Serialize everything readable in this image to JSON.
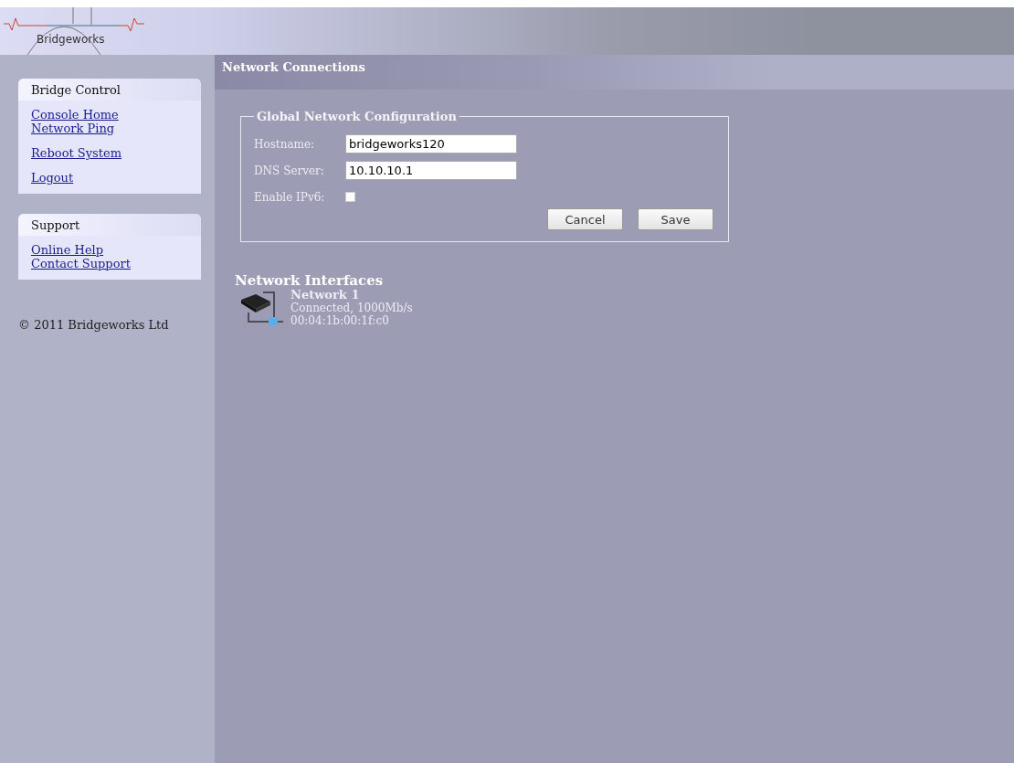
{
  "logo": {
    "text": "Bridgeworks"
  },
  "sidebar": {
    "panels": [
      {
        "title": "Bridge Control",
        "groups": [
          [
            "Console Home",
            "Network Ping"
          ],
          [
            "Reboot System"
          ],
          [
            "Logout"
          ]
        ]
      },
      {
        "title": "Support",
        "groups": [
          [
            "Online Help",
            "Contact Support"
          ]
        ]
      }
    ],
    "copyright": "© 2011 Bridgeworks Ltd"
  },
  "page_title": "Network Connections",
  "config": {
    "legend": "Global Network Configuration",
    "fields": [
      {
        "kind": "text",
        "label": "Hostname:",
        "value": "bridgeworks120"
      },
      {
        "kind": "text",
        "label": "DNS Server:",
        "value": "10.10.10.1"
      },
      {
        "kind": "checkbox",
        "label": "Enable IPv6:",
        "checked": false
      }
    ],
    "buttons": [
      "Cancel",
      "Save"
    ]
  },
  "interfaces": {
    "title": "Network Interfaces",
    "items": [
      {
        "name": "Network 1",
        "status": "Connected, 1000Mb/s",
        "mac": "00:04:1b:00:1f:c0"
      }
    ]
  }
}
